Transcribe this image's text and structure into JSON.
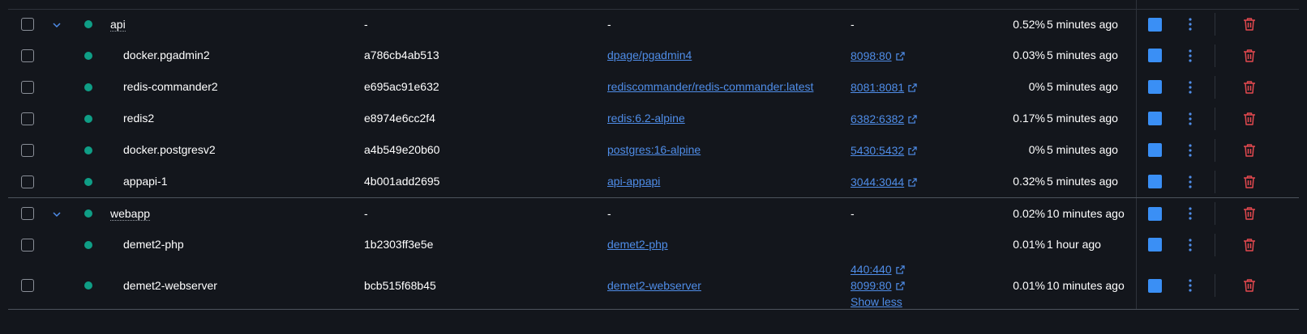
{
  "colors": {
    "background": "#13161c",
    "running": "#0f9e86",
    "link": "#4f8de8",
    "action": "#3a8ff5",
    "delete": "#e4494f"
  },
  "icons": {
    "checkbox": "checkbox-icon",
    "expand": "chevron-down-icon",
    "status": "status-dot-icon",
    "external": "external-link-icon",
    "stop": "stop-icon",
    "menu": "kebab-menu-icon",
    "delete": "trash-icon"
  },
  "groups": [
    {
      "name": "api",
      "container_id": "-",
      "image": "-",
      "port": "-",
      "cpu": "0.52%",
      "last_started": "5 minutes ago",
      "containers": [
        {
          "name": "docker.pgadmin2",
          "container_id": "a786cb4ab513",
          "image": "dpage/pgadmin4",
          "ports": [
            "8098:80"
          ],
          "cpu": "0.03%",
          "last_started": "5 minutes ago"
        },
        {
          "name": "redis-commander2",
          "container_id": "e695ac91e632",
          "image": "rediscommander/redis-commander:latest",
          "ports": [
            "8081:8081"
          ],
          "cpu": "0%",
          "last_started": "5 minutes ago"
        },
        {
          "name": "redis2",
          "container_id": "e8974e6cc2f4",
          "image": "redis:6.2-alpine",
          "ports": [
            "6382:6382"
          ],
          "cpu": "0.17%",
          "last_started": "5 minutes ago"
        },
        {
          "name": "docker.postgresv2",
          "container_id": "a4b549e20b60",
          "image": "postgres:16-alpine",
          "ports": [
            "5430:5432"
          ],
          "cpu": "0%",
          "last_started": "5 minutes ago"
        },
        {
          "name": "appapi-1",
          "container_id": "4b001add2695",
          "image": "api-appapi",
          "ports": [
            "3044:3044"
          ],
          "cpu": "0.32%",
          "last_started": "5 minutes ago"
        }
      ]
    },
    {
      "name": "webapp",
      "container_id": "-",
      "image": "-",
      "port": "-",
      "cpu": "0.02%",
      "last_started": "10 minutes ago",
      "containers": [
        {
          "name": "demet2-php",
          "container_id": "1b2303ff3e5e",
          "image": "demet2-php",
          "ports": [],
          "cpu": "0.01%",
          "last_started": "1 hour ago"
        },
        {
          "name": "demet2-webserver",
          "container_id": "bcb515f68b45",
          "image": "demet2-webserver",
          "ports": [
            "440:440",
            "8099:80"
          ],
          "show_less": "Show less",
          "cpu": "0.01%",
          "last_started": "10 minutes ago"
        }
      ]
    }
  ]
}
